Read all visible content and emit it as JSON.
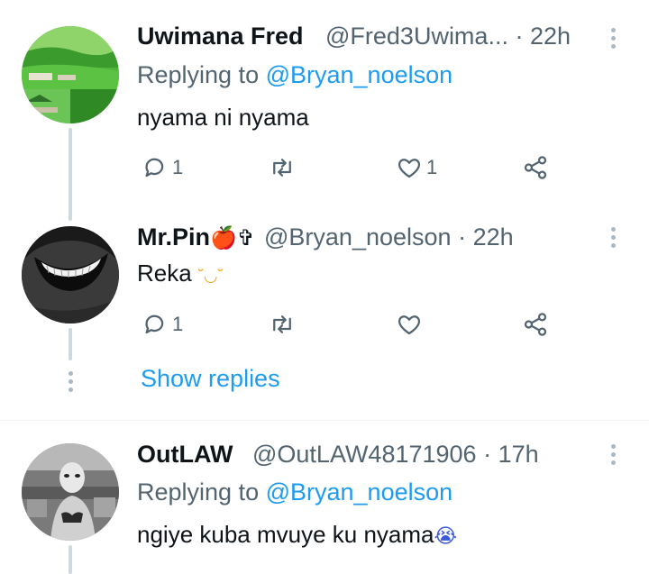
{
  "tweets": [
    {
      "name": "Uwimana Fred",
      "handle": "@Fred3Uwima...",
      "sep": "·",
      "time": "22h",
      "replying_prefix": "Replying to ",
      "replying_to": "@Bryan_noelson",
      "text": "nyama ni nyama",
      "replies": "1",
      "retweets": "",
      "likes": "1"
    },
    {
      "name": "Mr.Pin",
      "name_emoji": "🍎✞",
      "handle": "@Bryan_noelson",
      "sep": "·",
      "time": "22h",
      "text": "Reka",
      "text_emoji": "˘◡˘",
      "replies": "1",
      "retweets": "",
      "likes": ""
    },
    {
      "name": "OutLAW",
      "handle": "@OutLAW48171906",
      "sep": "·",
      "time": "17h",
      "replying_prefix": "Replying to ",
      "replying_to": "@Bryan_noelson",
      "text": "ngiye kuba mvuye ku nyama",
      "text_emoji": "😭"
    }
  ],
  "show_replies": "Show replies",
  "colors": {
    "accent": "#1d9bf0",
    "secondary_text": "#536471",
    "thread_line": "#cfd9de"
  }
}
